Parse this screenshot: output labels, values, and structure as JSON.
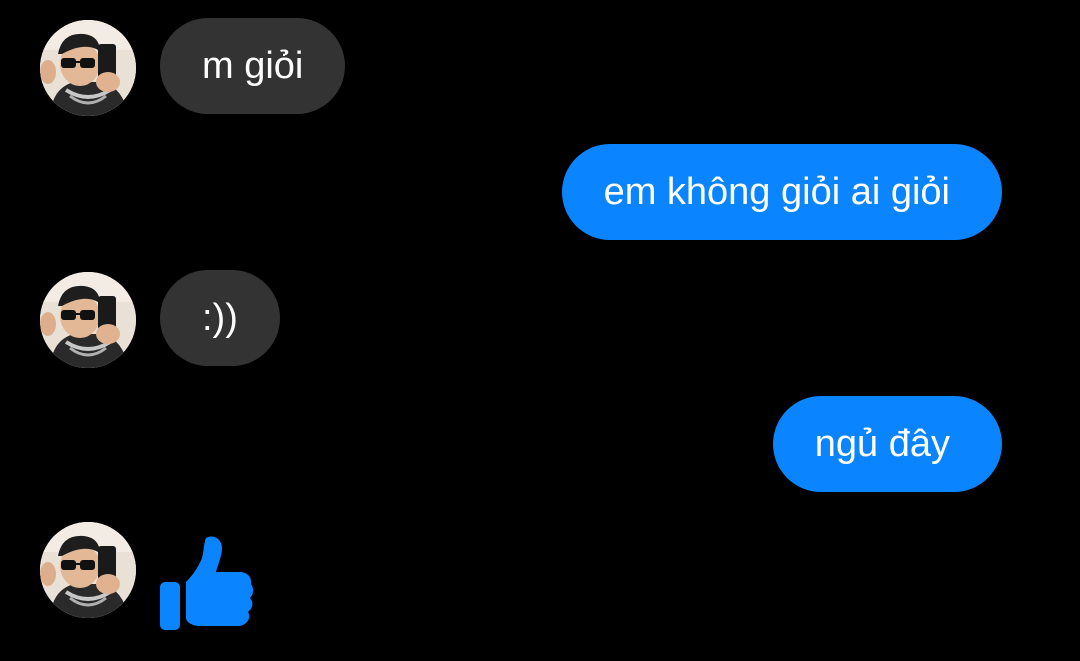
{
  "conversation": {
    "messages": [
      {
        "sender": "contact",
        "text": "m giỏi"
      },
      {
        "sender": "me",
        "text": "em không giỏi ai giỏi"
      },
      {
        "sender": "contact",
        "text": ":))"
      },
      {
        "sender": "me",
        "text": "ngủ đây"
      },
      {
        "sender": "contact",
        "sticker": "thumbs-up-icon"
      }
    ]
  },
  "colors": {
    "background": "#000000",
    "incoming_bubble": "#333333",
    "outgoing_bubble": "#0a84ff",
    "like_icon": "#0a84ff",
    "text": "#ffffff"
  }
}
